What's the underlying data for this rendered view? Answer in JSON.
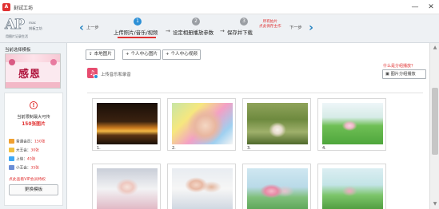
{
  "window": {
    "title": "刻试工坊",
    "minimize": "—",
    "close": "✕"
  },
  "logo": {
    "mark": "AP",
    "tagline": "mac",
    "tagline2": "刻板工坊",
    "sub": "用图片记录生活"
  },
  "nav": {
    "prev_label": "上一步",
    "next_label": "下一步",
    "preview_note": "所有拍片\n点此保存主作",
    "steps": [
      {
        "num": "1",
        "label": "上传照片/音乐/视频",
        "active": true
      },
      {
        "num": "2",
        "label": "设定相册播放参数",
        "active": false
      },
      {
        "num": "3",
        "label": "保存并下载",
        "active": false
      }
    ],
    "arrow": "→"
  },
  "sidebar": {
    "title": "当前选择模板",
    "template_text": "感恩",
    "limit_text": "当前限制最大可传",
    "limit_num": "150张图片",
    "members": [
      {
        "label": "普通会员：",
        "count": "150张",
        "color": "#f0a030"
      },
      {
        "label": "大王会：",
        "count": "30张",
        "color": "#f0c040"
      },
      {
        "label": "上佳：",
        "count": "40张",
        "color": "#3fa9f5"
      },
      {
        "label": "小王会：",
        "count": "35张",
        "color": "#6c8ed6"
      }
    ],
    "vip_note": "点此查看VIP会员特权",
    "change_button": "更换模板"
  },
  "toolbar": {
    "local_image": "本地图片",
    "personal_image": "+ 个人中心图片",
    "personal_video": "+ 个人中心视频",
    "music_label": "上传音乐和录音",
    "group_help": "什么是分组播放？",
    "group_button": "图片分组播放"
  },
  "photos": [
    {
      "num": "1."
    },
    {
      "num": "2."
    },
    {
      "num": "3."
    },
    {
      "num": "4."
    },
    {
      "num": ""
    },
    {
      "num": ""
    },
    {
      "num": ""
    },
    {
      "num": ""
    }
  ],
  "scroll": {
    "up": "▲",
    "down": "▼"
  }
}
